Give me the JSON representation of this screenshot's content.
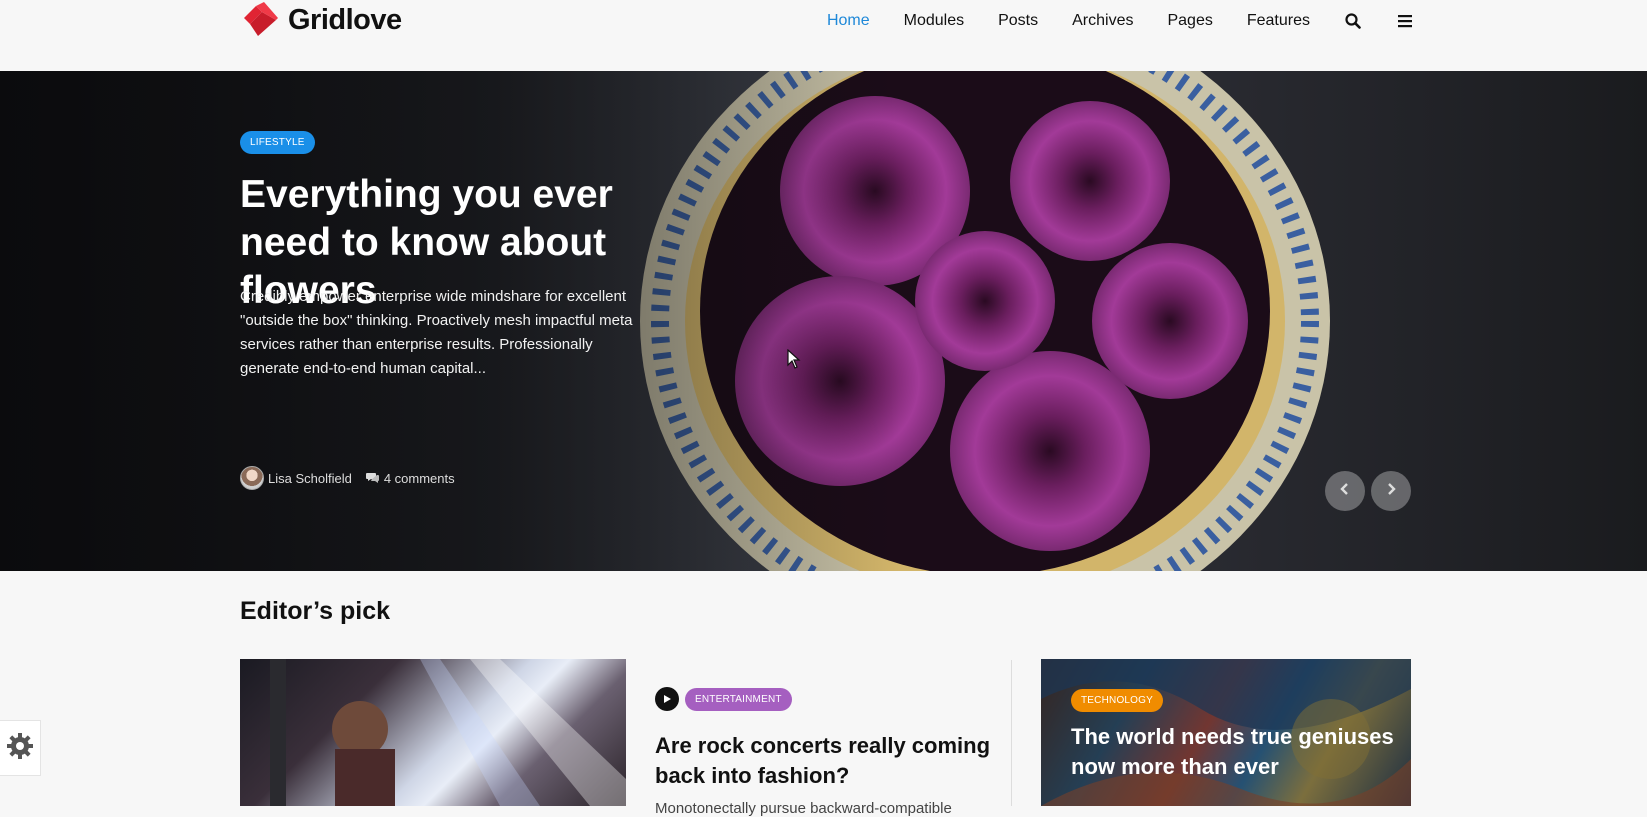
{
  "logo": {
    "text": "Gridlove"
  },
  "nav": {
    "items": [
      {
        "label": "Home",
        "active": true
      },
      {
        "label": "Modules"
      },
      {
        "label": "Posts"
      },
      {
        "label": "Archives"
      },
      {
        "label": "Pages"
      },
      {
        "label": "Features"
      }
    ]
  },
  "hero": {
    "category": "LIFESTYLE",
    "title": "Everything you ever need to know about flowers",
    "excerpt": "Credibly empower enterprise wide mindshare for excellent \"outside the box\" thinking. Proactively mesh impactful meta services rather than enterprise results. Professionally generate end-to-end human capital...",
    "author": "Lisa Scholfield",
    "comments": "4 comments"
  },
  "editors_pick": {
    "title": "Editor’s pick",
    "card2": {
      "category": "ENTERTAINMENT",
      "title": "Are rock concerts really coming back into fashion?",
      "excerpt": "Monotonectally pursue backward-compatible"
    },
    "card3": {
      "category": "TECHNOLOGY",
      "title": "The world needs true geniuses now more than ever"
    }
  },
  "colors": {
    "accent": "#1e88d8",
    "lifestyle": "#1a8fe8",
    "entertainment": "#a55fc0",
    "technology": "#f08c00",
    "logo_red": "#e02433"
  },
  "icons": [
    "search-icon",
    "menu-icon",
    "chevron-left-icon",
    "chevron-right-icon",
    "comment-icon",
    "play-icon",
    "gear-icon"
  ]
}
